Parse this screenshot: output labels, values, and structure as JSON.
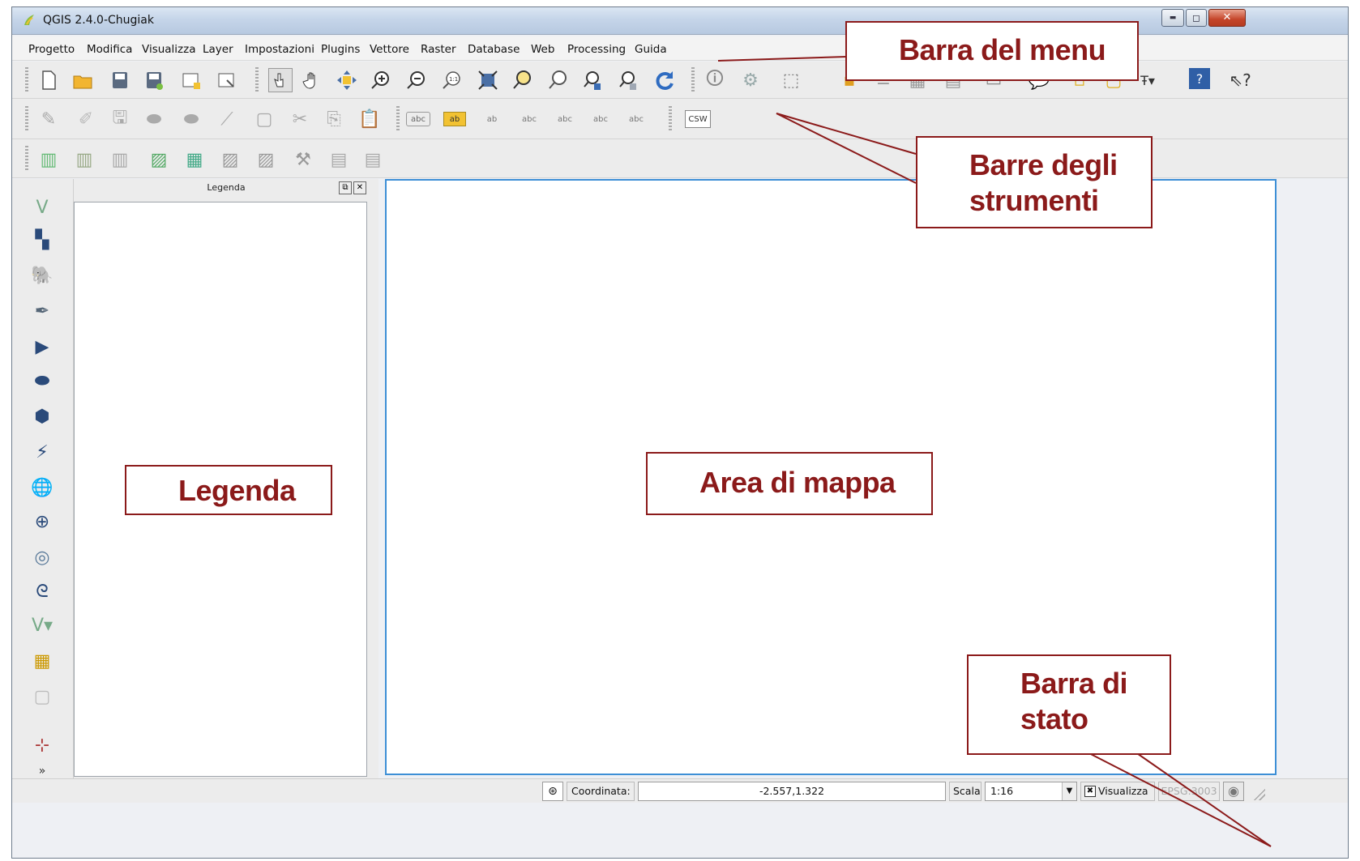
{
  "window": {
    "title": "QGIS 2.4.0-Chugiak",
    "minimize": "▬",
    "maximize": "◻",
    "close": "✕"
  },
  "menu": [
    "Progetto",
    "Modifica",
    "Visualizza",
    "Layer",
    "Impostazioni",
    "Plugins",
    "Vettore",
    "Raster",
    "Database",
    "Web",
    "Processing",
    "Guida"
  ],
  "toolbars": {
    "row1_icons": [
      "new-project-icon",
      "open-folder-icon",
      "save-icon",
      "save-as-icon",
      "new-print-composer-icon",
      "composer-manager-icon",
      "touch-zoom-icon",
      "pan-hand-icon",
      "pan-to-selection-icon",
      "zoom-in-icon",
      "zoom-out-icon",
      "zoom-native-icon",
      "zoom-full-icon",
      "zoom-to-selection-icon",
      "zoom-to-layer-icon",
      "zoom-last-icon",
      "zoom-next-icon",
      "refresh-icon",
      "identify-icon",
      "map-tips-icon",
      "select-features-icon",
      "deselect-icon",
      "attribute-table-icon",
      "field-calculator-icon",
      "statistics-icon",
      "measure-icon",
      "annotation-icon",
      "bookmark-icon",
      "new-bookmark-icon",
      "text-annotation-icon",
      "help-icon",
      "whats-this-icon"
    ],
    "row2_label": "CSW",
    "row2_labels": [
      "abc",
      "ab",
      "ab",
      "abc",
      "abc",
      "abc",
      "abc"
    ],
    "row3_icons": [
      "raster-calculator-icon",
      "raster-layer-add-icon",
      "raster-georef-icon",
      "vector-add-icon",
      "vector-join-icon",
      "vector-digitize-icon",
      "vector-edit-icon",
      "tools-icon",
      "layer-info-icon",
      "layer-export-icon"
    ]
  },
  "legend": {
    "title": "Legenda",
    "float_btn": "⧉",
    "close_btn": "✕"
  },
  "status": {
    "coord_label": "Coordinata:",
    "coord_value": "-2.557,1.322",
    "scale_label": "Scala",
    "scale_value": "1:16",
    "render_label": "Visualizza",
    "render_checked": "✖",
    "crs": "EPSG:3003"
  },
  "callouts": {
    "menubar": "Barra del menu",
    "toolbars_line1": "Barre degli",
    "toolbars_line2": "strumenti",
    "legend": "Legenda",
    "map": "Area di mappa",
    "statusbar_line1": "Barra di",
    "statusbar_line2": "stato"
  },
  "colors": {
    "callout": "#8b1a1a",
    "map_border": "#3d8fd6"
  }
}
